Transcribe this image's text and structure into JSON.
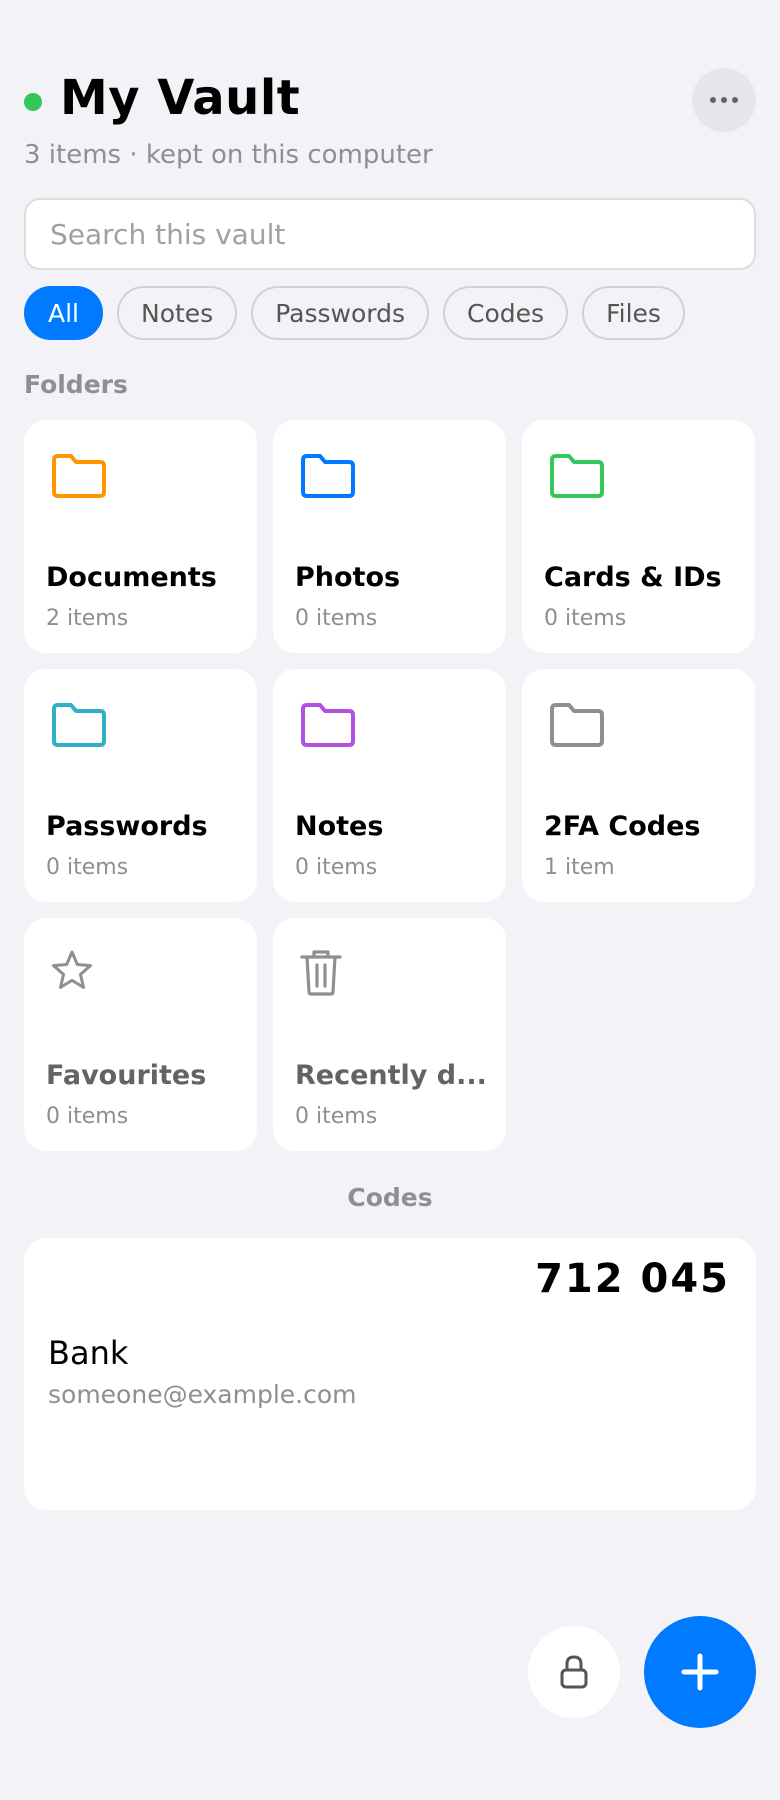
{
  "header": {
    "title": "My Vault",
    "subtitle": "3 items · kept on this computer",
    "status_color": "#34c759",
    "more_icon": "ellipsis-icon"
  },
  "search": {
    "placeholder": "Search this vault",
    "value": ""
  },
  "filters": [
    {
      "label": "All",
      "active": true
    },
    {
      "label": "Notes",
      "active": false
    },
    {
      "label": "Passwords",
      "active": false
    },
    {
      "label": "Codes",
      "active": false
    },
    {
      "label": "Files",
      "active": false
    }
  ],
  "folders_section": {
    "label": "Folders",
    "items": [
      {
        "name": "Documents",
        "count": "2 items",
        "icon": "folder-icon",
        "color": "#ff9500"
      },
      {
        "name": "Photos",
        "count": "0 items",
        "icon": "folder-icon",
        "color": "#007aff"
      },
      {
        "name": "Cards & IDs",
        "count": "0 items",
        "icon": "folder-icon",
        "color": "#34c759"
      },
      {
        "name": "Passwords",
        "count": "0 items",
        "icon": "folder-icon",
        "color": "#30b0c7"
      },
      {
        "name": "Notes",
        "count": "0 items",
        "icon": "folder-icon",
        "color": "#af52de"
      },
      {
        "name": "2FA Codes",
        "count": "1 item",
        "icon": "folder-icon",
        "color": "#8e8e93"
      },
      {
        "name": "Favourites",
        "count": "0 items",
        "icon": "star-icon",
        "color": "#8e8e93"
      },
      {
        "name": "Recently d...",
        "count": "0 items",
        "icon": "trash-icon",
        "color": "#8e8e93"
      }
    ]
  },
  "codes_section": {
    "label": "Codes",
    "items": [
      {
        "code": "712 045",
        "name": "Bank",
        "account": "someone@example.com"
      }
    ]
  },
  "actions": {
    "lock_icon": "lock-icon",
    "add_icon": "plus-icon",
    "accent": "#007aff"
  }
}
